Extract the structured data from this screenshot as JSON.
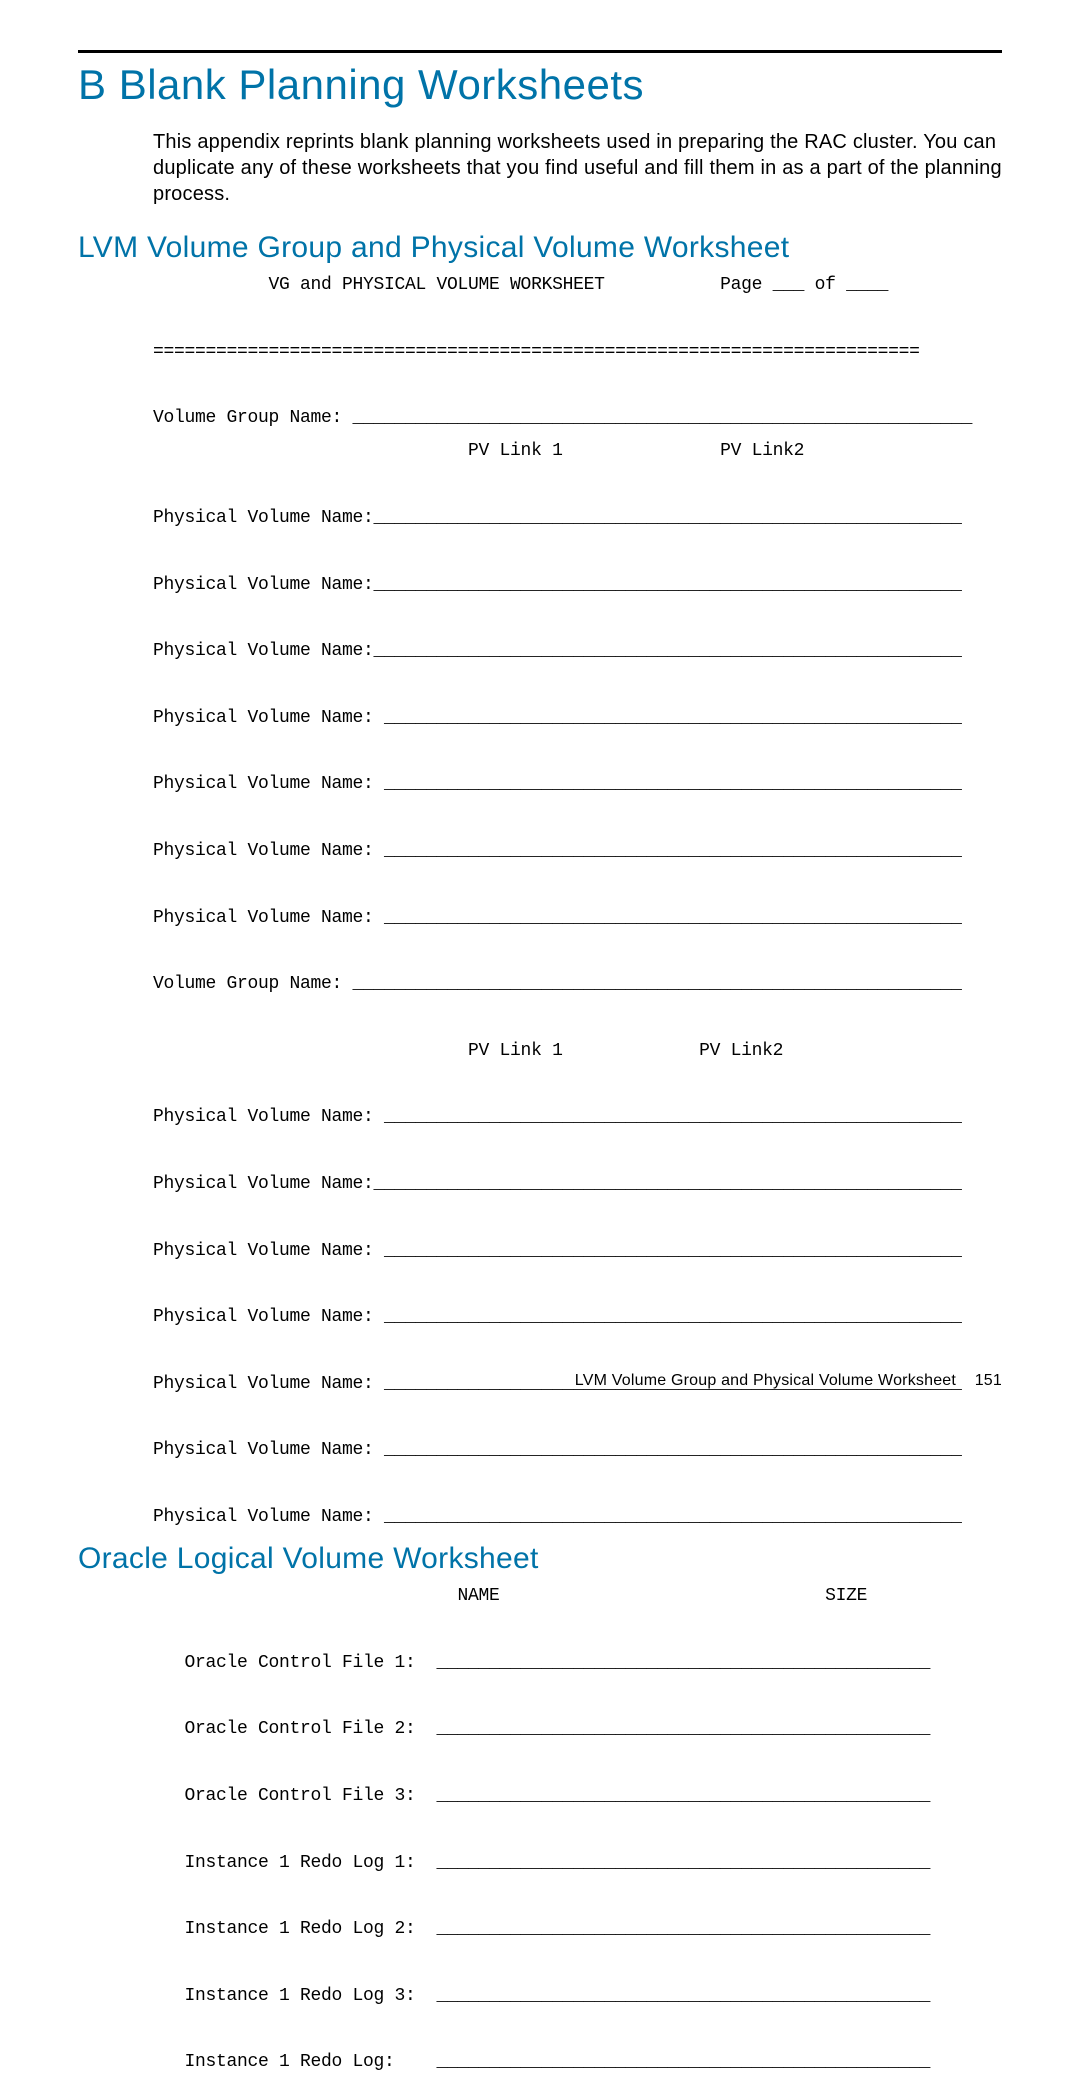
{
  "appendix": {
    "letter": "B",
    "title": "Blank Planning Worksheets",
    "intro": "This appendix reprints blank planning worksheets used in preparing the RAC cluster. You can duplicate any of these worksheets that you find useful and fill them in as a part of the planning process."
  },
  "sections": {
    "lvm": {
      "title": "LVM Volume Group and Physical Volume Worksheet",
      "body": "           VG and PHYSICAL VOLUME WORKSHEET           Page ___ of ____\n\n=========================================================================\n\nVolume Group Name: ___________________________________________________________\n                              PV Link 1               PV Link2\n\nPhysical Volume Name:________________________________________________________\n\nPhysical Volume Name:________________________________________________________\n\nPhysical Volume Name:________________________________________________________\n\nPhysical Volume Name: _______________________________________________________\n\nPhysical Volume Name: _______________________________________________________\n\nPhysical Volume Name: _______________________________________________________\n\nPhysical Volume Name: _______________________________________________________\n\nVolume Group Name: __________________________________________________________\n\n                              PV Link 1             PV Link2\n\nPhysical Volume Name: _______________________________________________________\n\nPhysical Volume Name:________________________________________________________\n\nPhysical Volume Name: _______________________________________________________\n\nPhysical Volume Name: _______________________________________________________\n\nPhysical Volume Name: _______________________________________________________\n\nPhysical Volume Name: _______________________________________________________\n\nPhysical Volume Name: _______________________________________________________"
    },
    "oracle": {
      "title": "Oracle Logical Volume Worksheet",
      "body": "                             NAME                               SIZE\n\n   Oracle Control File 1:  _______________________________________________\n\n   Oracle Control File 2:  _______________________________________________\n\n   Oracle Control File 3:  _______________________________________________\n\n   Instance 1 Redo Log 1:  _______________________________________________\n\n   Instance 1 Redo Log 2:  _______________________________________________\n\n   Instance 1 Redo Log 3:  _______________________________________________\n\n   Instance 1 Redo Log:    _______________________________________________"
    }
  },
  "footer": {
    "text": "LVM Volume Group and Physical Volume Worksheet",
    "page": "151"
  }
}
